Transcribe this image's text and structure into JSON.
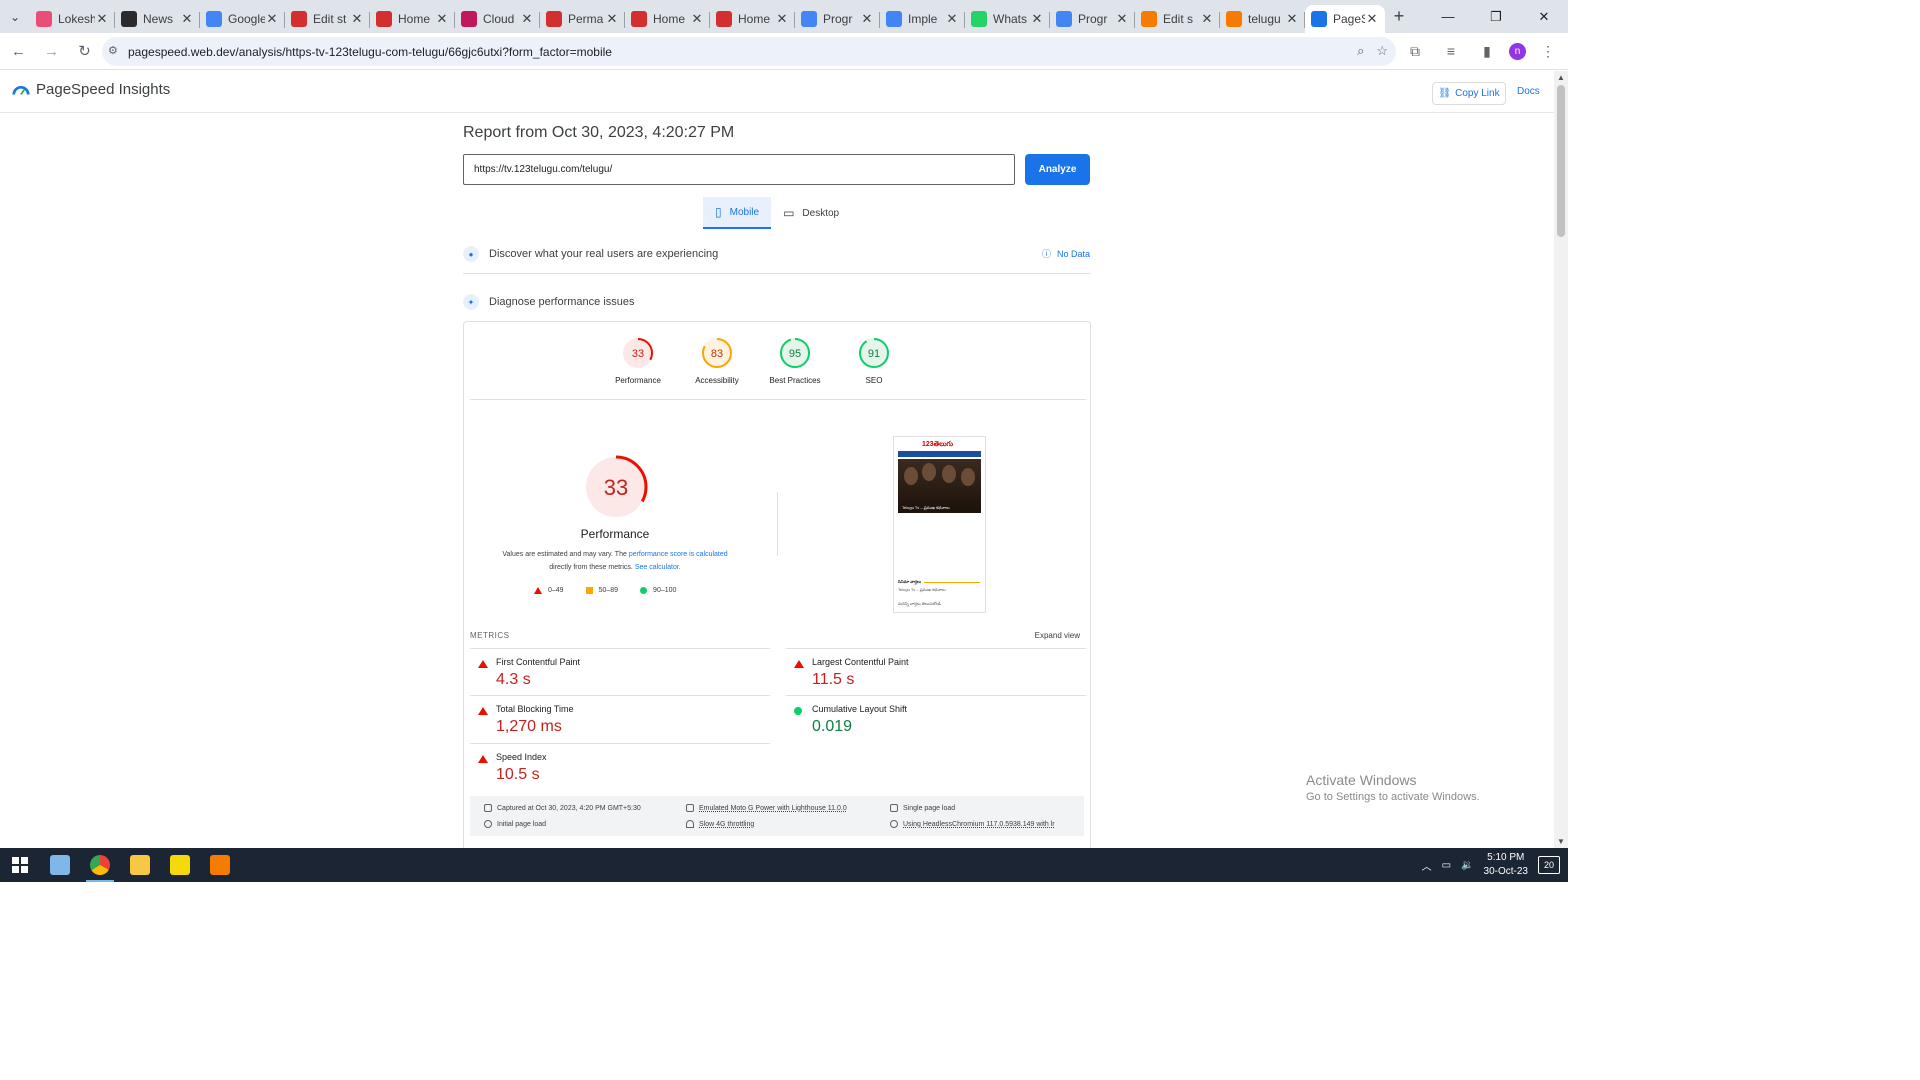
{
  "browser": {
    "tabs": [
      {
        "label": "Lokesh",
        "favicon_color": "#e94e77"
      },
      {
        "label": "News",
        "favicon_color": "#2b2b2b"
      },
      {
        "label": "Google",
        "favicon_color": "#4285f4"
      },
      {
        "label": "Edit st",
        "favicon_color": "#d32f2f"
      },
      {
        "label": "Home",
        "favicon_color": "#d32f2f"
      },
      {
        "label": "Cloud",
        "favicon_color": "#c2185b"
      },
      {
        "label": "Perma",
        "favicon_color": "#d32f2f"
      },
      {
        "label": "Home",
        "favicon_color": "#d32f2f"
      },
      {
        "label": "Home",
        "favicon_color": "#d32f2f"
      },
      {
        "label": "Progr",
        "favicon_color": "#4285f4"
      },
      {
        "label": "Imple",
        "favicon_color": "#4285f4"
      },
      {
        "label": "Whats",
        "favicon_color": "#25d366"
      },
      {
        "label": "Progr",
        "favicon_color": "#4285f4"
      },
      {
        "label": "Edit s",
        "favicon_color": "#f57c00"
      },
      {
        "label": "telugu",
        "favicon_color": "#f57c00"
      },
      {
        "label": "PageS",
        "favicon_color": "#1a73e8",
        "active": true
      }
    ],
    "url": "pagespeed.web.dev/analysis/https-tv-123telugu-com-telugu/66gjc6utxi?form_factor=mobile"
  },
  "header": {
    "product_name": "PageSpeed Insights",
    "copy_link_label": "Copy Link",
    "docs_label": "Docs"
  },
  "report": {
    "title": "Report from Oct 30, 2023, 4:20:27 PM",
    "url_value": "https://tv.123telugu.com/telugu/",
    "analyze_label": "Analyze",
    "mobile_tab": "Mobile",
    "desktop_tab": "Desktop",
    "real_users_heading": "Discover what your real users are experiencing",
    "no_data_label": "No Data",
    "diagnose_heading": "Diagnose performance issues"
  },
  "scores": [
    {
      "label": "Performance",
      "value": 33,
      "color": "#eb0f00",
      "text_color": "#c5221f",
      "bg": "#fce8e6"
    },
    {
      "label": "Accessibility",
      "value": 83,
      "color": "#ffa400",
      "text_color": "#c33300",
      "bg": "#fff3e0"
    },
    {
      "label": "Best Practices",
      "value": 95,
      "color": "#0cce6b",
      "text_color": "#0d8043",
      "bg": "#e6f4ea"
    },
    {
      "label": "SEO",
      "value": 91,
      "color": "#0cce6b",
      "text_color": "#0d8043",
      "bg": "#e6f4ea"
    }
  ],
  "performance": {
    "score": "33",
    "label": "Performance",
    "note_prefix": "Values are estimated and may vary. The ",
    "note_link1": "performance score is calculated",
    "note_mid": " directly from these metrics. ",
    "note_link2": "See calculator.",
    "legend_fail": "0–49",
    "legend_average": "50–89",
    "legend_pass": "90–100"
  },
  "screenshot": {
    "site_logo": "123తెలుగు",
    "caption1": "Telugu Tv – ప్రముఖ కథనాలు",
    "caption2": "సినిమా వార్తలు",
    "caption3": "మరిన్ని వార్తలు తెలుసుకోండి"
  },
  "metrics": {
    "header": "METRICS",
    "expand_label": "Expand view",
    "items": [
      {
        "name": "First Contentful Paint",
        "value": "4.3 s",
        "status": "fail"
      },
      {
        "name": "Largest Contentful Paint",
        "value": "11.5 s",
        "status": "fail"
      },
      {
        "name": "Total Blocking Time",
        "value": "1,270 ms",
        "status": "fail"
      },
      {
        "name": "Cumulative Layout Shift",
        "value": "0.019",
        "status": "pass"
      },
      {
        "name": "Speed Index",
        "value": "10.5 s",
        "status": "fail"
      }
    ]
  },
  "footer_info": {
    "captured": "Captured at Oct 30, 2023, 4:20 PM GMT+5:30",
    "initial_load": "Initial page load",
    "device": "Emulated Moto G Power with Lighthouse 11.0.0",
    "throttling": "Slow 4G throttling",
    "session": "Single page load",
    "browser": "Using HeadlessChromium 117.0.5938.149 with lr"
  },
  "watermark": {
    "title": "Activate Windows",
    "subtitle": "Go to Settings to activate Windows."
  },
  "taskbar": {
    "time": "5:10 PM",
    "date": "30-Oct-23",
    "notification_count": "20"
  }
}
